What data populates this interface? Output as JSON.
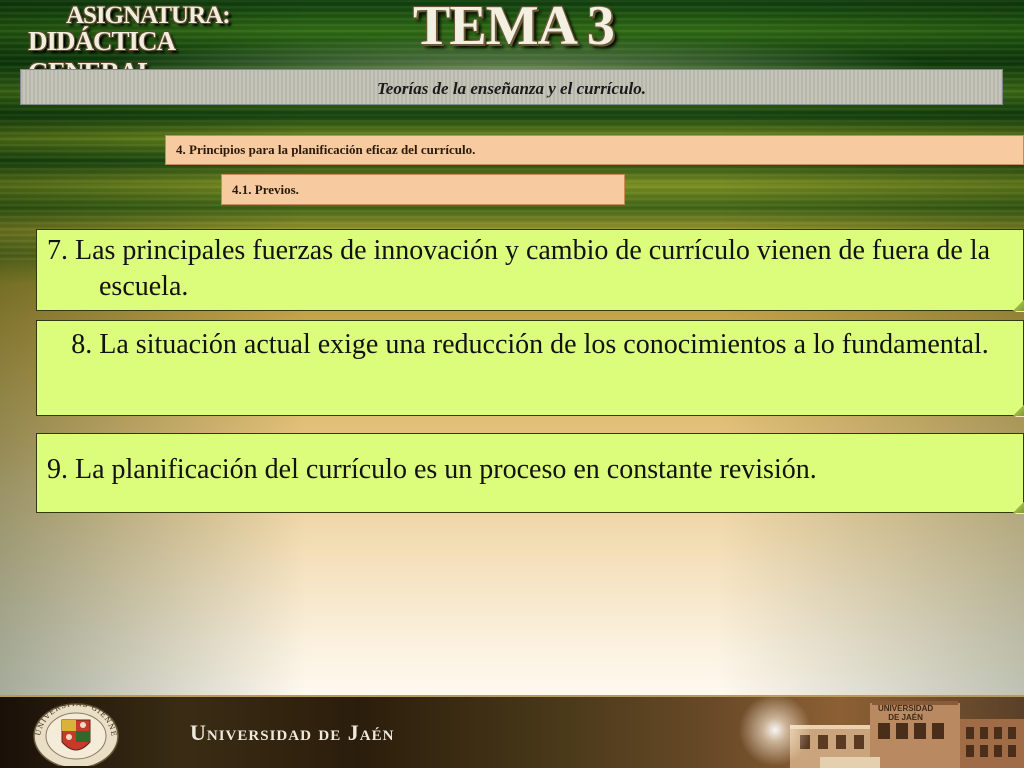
{
  "header": {
    "asignatura_line1": "ASIGNATURA:",
    "asignatura_line2": "DIDÁCTICA GENERAL",
    "tema": "TEMA 3"
  },
  "subtitle": "Teorías de la enseñanza y el currículo.",
  "sections": {
    "section_4": "4. Principios para la planificación eficaz del currículo.",
    "section_4_1": "4.1. Previos."
  },
  "principles": [
    {
      "text": "7. Las principales fuerzas de innovación y cambio de currículo vienen de fuera de la escuela."
    },
    {
      "text": "8. La situación actual exige una reducción de los conocimientos a lo fundamental."
    },
    {
      "text": "9. La planificación del currículo es un proceso en constante revisión."
    }
  ],
  "footer": {
    "university": "Universidad de Jaén",
    "building_sign_line1": "UNIVERSIDAD",
    "building_sign_line2": "DE JAÉN",
    "crest_motto": "UNIVERSITAS GIENNENSIS"
  },
  "colors": {
    "principle_box": "#dcfc7c",
    "section_box": "#f7caa0",
    "subtitle_band": "#c0c0b4"
  }
}
